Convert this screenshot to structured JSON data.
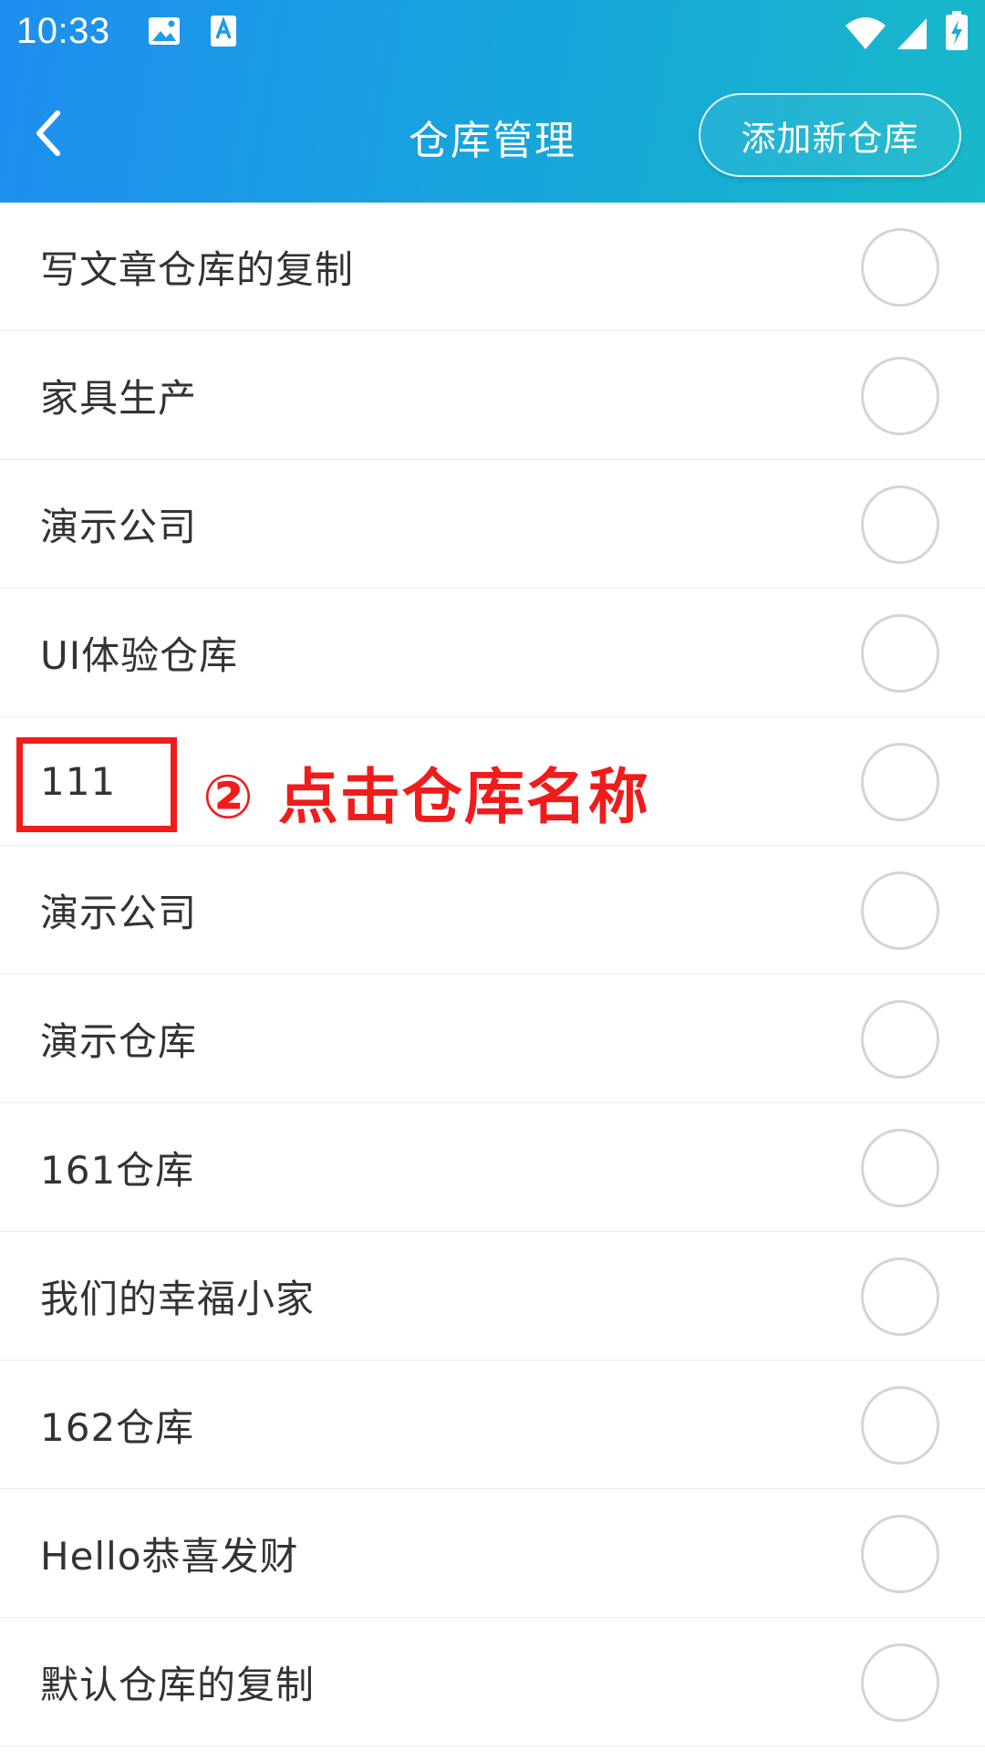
{
  "status_bar": {
    "time": "10:33"
  },
  "toolbar": {
    "title": "仓库管理",
    "add_button_label": "添加新仓库"
  },
  "list": {
    "items": [
      {
        "label": "写文章仓库的复制",
        "selected": false
      },
      {
        "label": "家具生产",
        "selected": false
      },
      {
        "label": "演示公司",
        "selected": false
      },
      {
        "label": "UI体验仓库",
        "selected": false
      },
      {
        "label": "111",
        "selected": false
      },
      {
        "label": "演示公司",
        "selected": false
      },
      {
        "label": "演示仓库",
        "selected": false
      },
      {
        "label": "161仓库",
        "selected": false
      },
      {
        "label": "我们的幸福小家",
        "selected": false
      },
      {
        "label": "162仓库",
        "selected": false
      },
      {
        "label": "Hello恭喜发财",
        "selected": false
      },
      {
        "label": "默认仓库的复制",
        "selected": false
      }
    ]
  },
  "annotation": {
    "text": "② 点击仓库名称",
    "color": "#f01c1c"
  },
  "colors": {
    "header_gradient_start": "#1e8ef0",
    "header_gradient_end": "#18b9c9",
    "radio_border": "#d4d4d4"
  }
}
